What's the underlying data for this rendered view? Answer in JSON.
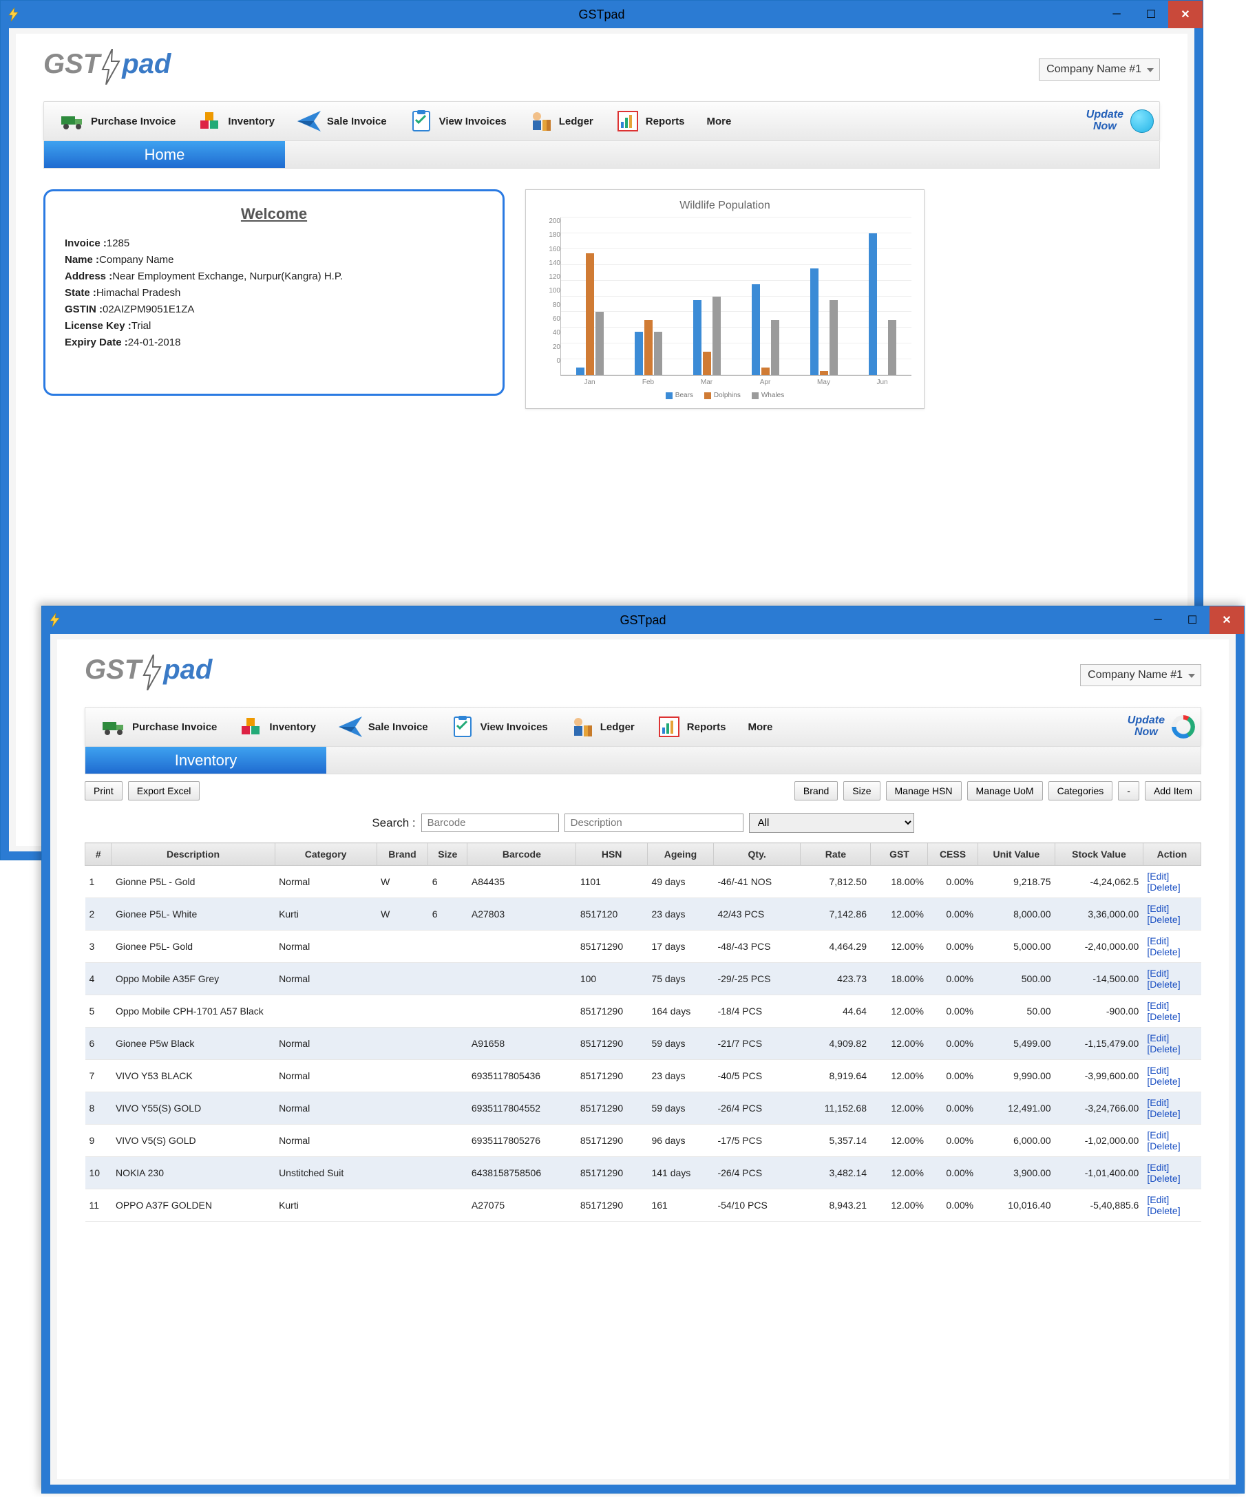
{
  "appTitle": "GSTpad",
  "logo": {
    "part1": "GST",
    "part2": "pad"
  },
  "companySelector": "Company Name #1",
  "updateNow": "Update\nNow",
  "toolbar": [
    {
      "label": "Purchase Invoice",
      "icon": "truck-icon"
    },
    {
      "label": "Inventory",
      "icon": "boxes-icon"
    },
    {
      "label": "Sale Invoice",
      "icon": "paperplane-icon"
    },
    {
      "label": "View Invoices",
      "icon": "clipboard-icon"
    },
    {
      "label": "Ledger",
      "icon": "ledger-icon"
    },
    {
      "label": "Reports",
      "icon": "report-icon"
    },
    {
      "label": "More",
      "icon": ""
    }
  ],
  "homeTab": "Home",
  "welcome": {
    "title": "Welcome",
    "lines": [
      {
        "label": "Invoice :",
        "value": "1285"
      },
      {
        "label": "Name :",
        "value": "Company Name"
      },
      {
        "label": "Address :",
        "value": "Near Employment Exchange, Nurpur(Kangra) H.P."
      },
      {
        "label": "State :",
        "value": "Himachal Pradesh"
      },
      {
        "label": "GSTIN :",
        "value": "02AIZPM9051E1ZA"
      },
      {
        "label": "License Key :",
        "value": "Trial"
      },
      {
        "label": "Expiry Date :",
        "value": "24-01-2018"
      }
    ]
  },
  "chart_data": {
    "type": "bar",
    "title": "Wildlife Population",
    "categories": [
      "Jan",
      "Feb",
      "Mar",
      "Apr",
      "May",
      "Jun"
    ],
    "series": [
      {
        "name": "Bears",
        "values": [
          10,
          55,
          95,
          115,
          135,
          180
        ]
      },
      {
        "name": "Dolphins",
        "values": [
          155,
          70,
          30,
          10,
          5,
          0
        ]
      },
      {
        "name": "Whales",
        "values": [
          80,
          55,
          100,
          70,
          95,
          70
        ]
      }
    ],
    "ylim": [
      0,
      200
    ],
    "yticks": [
      0,
      20,
      40,
      60,
      80,
      100,
      120,
      140,
      160,
      180,
      200
    ],
    "xlabel": "",
    "ylabel": ""
  },
  "inventoryTab": "Inventory",
  "invButtonsLeft": [
    "Print",
    "Export Excel"
  ],
  "invButtonsRight": [
    "Brand",
    "Size",
    "Manage HSN",
    "Manage UoM",
    "Categories",
    "-",
    "Add Item"
  ],
  "search": {
    "label": "Search :",
    "barcodePlaceholder": "Barcode",
    "descPlaceholder": "Description",
    "filterAll": "All"
  },
  "columns": [
    "#",
    "Description",
    "Category",
    "Brand",
    "Size",
    "Barcode",
    "HSN",
    "Ageing",
    "Qty.",
    "Rate",
    "GST",
    "CESS",
    "Unit Value",
    "Stock Value",
    "Action"
  ],
  "actionLinks": {
    "edit": "[Edit]",
    "delete": "[Delete]"
  },
  "rows": [
    {
      "n": "1",
      "desc": "Gionne P5L - Gold",
      "cat": "Normal",
      "brand": "W",
      "size": "6",
      "barcode": "A84435",
      "hsn": "1101",
      "age": "49 days",
      "qty": "-46/-41 NOS",
      "rate": "7,812.50",
      "gst": "18.00%",
      "cess": "0.00%",
      "unit": "9,218.75",
      "stock": "-4,24,062.5"
    },
    {
      "n": "2",
      "desc": "Gionee P5L- White",
      "cat": "Kurti",
      "brand": "W",
      "size": "6",
      "barcode": "A27803",
      "hsn": "8517120",
      "age": "23 days",
      "qty": "42/43 PCS",
      "rate": "7,142.86",
      "gst": "12.00%",
      "cess": "0.00%",
      "unit": "8,000.00",
      "stock": "3,36,000.00"
    },
    {
      "n": "3",
      "desc": "Gionee P5L- Gold",
      "cat": "Normal",
      "brand": "",
      "size": "",
      "barcode": "",
      "hsn": "85171290",
      "age": "17 days",
      "qty": "-48/-43 PCS",
      "rate": "4,464.29",
      "gst": "12.00%",
      "cess": "0.00%",
      "unit": "5,000.00",
      "stock": "-2,40,000.00"
    },
    {
      "n": "4",
      "desc": "Oppo Mobile A35F Grey",
      "cat": "Normal",
      "brand": "",
      "size": "",
      "barcode": "",
      "hsn": "100",
      "age": "75 days",
      "qty": "-29/-25 PCS",
      "rate": "423.73",
      "gst": "18.00%",
      "cess": "0.00%",
      "unit": "500.00",
      "stock": "-14,500.00"
    },
    {
      "n": "5",
      "desc": "Oppo Mobile CPH-1701 A57 Black",
      "cat": "",
      "brand": "",
      "size": "",
      "barcode": "",
      "hsn": "85171290",
      "age": "164 days",
      "qty": "-18/4 PCS",
      "rate": "44.64",
      "gst": "12.00%",
      "cess": "0.00%",
      "unit": "50.00",
      "stock": "-900.00"
    },
    {
      "n": "6",
      "desc": "Gionee P5w Black",
      "cat": "Normal",
      "brand": "",
      "size": "",
      "barcode": "A91658",
      "hsn": "85171290",
      "age": "59 days",
      "qty": "-21/7 PCS",
      "rate": "4,909.82",
      "gst": "12.00%",
      "cess": "0.00%",
      "unit": "5,499.00",
      "stock": "-1,15,479.00"
    },
    {
      "n": "7",
      "desc": "VIVO Y53 BLACK",
      "cat": "Normal",
      "brand": "",
      "size": "",
      "barcode": "6935117805436",
      "hsn": "85171290",
      "age": "23 days",
      "qty": "-40/5 PCS",
      "rate": "8,919.64",
      "gst": "12.00%",
      "cess": "0.00%",
      "unit": "9,990.00",
      "stock": "-3,99,600.00"
    },
    {
      "n": "8",
      "desc": "VIVO Y55(S) GOLD",
      "cat": "Normal",
      "brand": "",
      "size": "",
      "barcode": "6935117804552",
      "hsn": "85171290",
      "age": "59 days",
      "qty": "-26/4 PCS",
      "rate": "11,152.68",
      "gst": "12.00%",
      "cess": "0.00%",
      "unit": "12,491.00",
      "stock": "-3,24,766.00"
    },
    {
      "n": "9",
      "desc": "VIVO V5(S) GOLD",
      "cat": "Normal",
      "brand": "",
      "size": "",
      "barcode": "6935117805276",
      "hsn": "85171290",
      "age": "96 days",
      "qty": "-17/5 PCS",
      "rate": "5,357.14",
      "gst": "12.00%",
      "cess": "0.00%",
      "unit": "6,000.00",
      "stock": "-1,02,000.00"
    },
    {
      "n": "10",
      "desc": "NOKIA 230",
      "cat": "Unstitched Suit",
      "brand": "",
      "size": "",
      "barcode": "6438158758506",
      "hsn": "85171290",
      "age": "141 days",
      "qty": "-26/4 PCS",
      "rate": "3,482.14",
      "gst": "12.00%",
      "cess": "0.00%",
      "unit": "3,900.00",
      "stock": "-1,01,400.00"
    },
    {
      "n": "11",
      "desc": "OPPO A37F GOLDEN",
      "cat": "Kurti",
      "brand": "",
      "size": "",
      "barcode": "A27075",
      "hsn": "85171290",
      "age": "161",
      "qty": "-54/10 PCS",
      "rate": "8,943.21",
      "gst": "12.00%",
      "cess": "0.00%",
      "unit": "10,016.40",
      "stock": "-5,40,885.6"
    }
  ]
}
